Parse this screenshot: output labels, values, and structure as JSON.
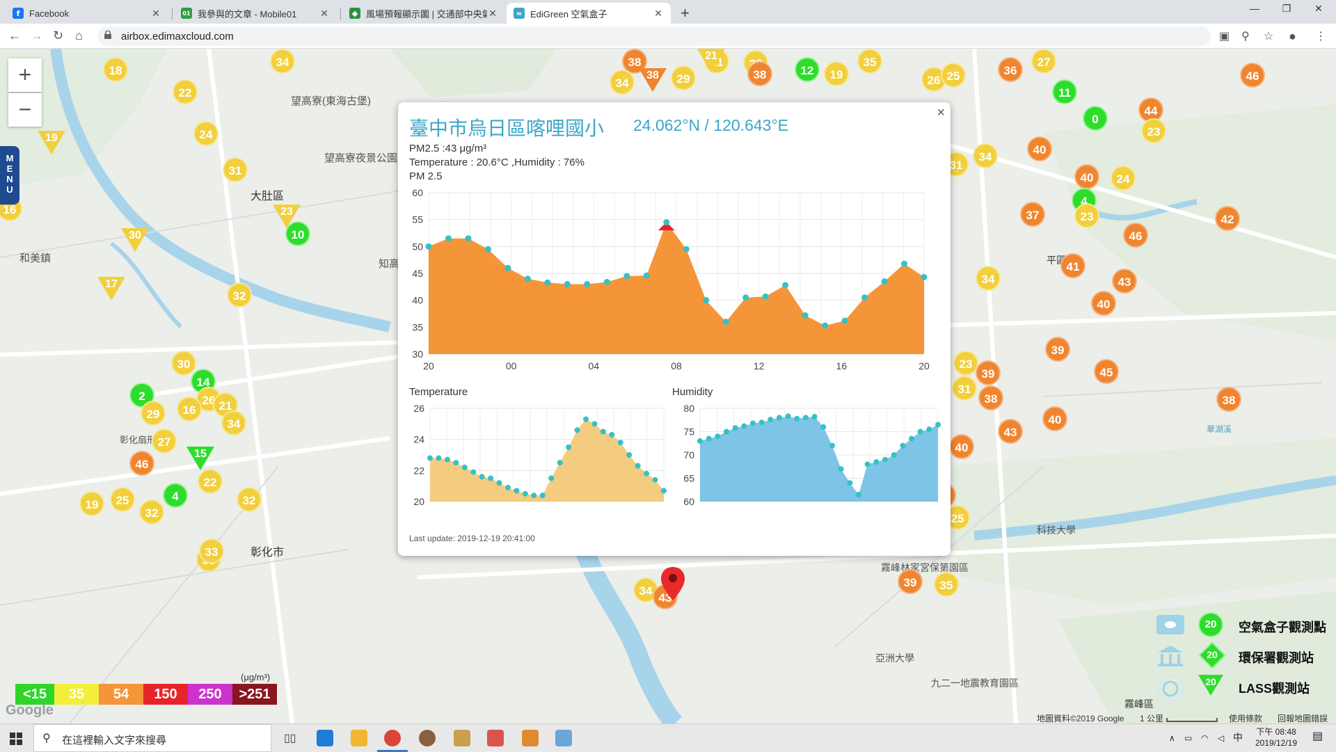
{
  "browser": {
    "tabs": [
      {
        "title": "Facebook",
        "icon": "facebook-icon",
        "color": "#1877f2",
        "glyph": "f",
        "active": false
      },
      {
        "title": "我參與的文章 - Mobile01",
        "icon": "mobile01-icon",
        "color": "#2f9e44",
        "glyph": "01",
        "active": false
      },
      {
        "title": "風場預報顯示圖 | 交通部中央氣象局",
        "icon": "cwb-icon",
        "color": "#2f8f3f",
        "glyph": "◆",
        "active": false
      },
      {
        "title": "EdiGreen 空氣盒子",
        "icon": "edigreen-icon",
        "color": "#3aa6c8",
        "glyph": "≈",
        "active": true
      }
    ],
    "url": "airbox.edimaxcloud.com"
  },
  "map": {
    "menu_label": [
      "M",
      "E",
      "N",
      "U"
    ],
    "zoom_in": "+",
    "zoom_out": "−",
    "place_labels": [
      "望高寮(東海古堡)",
      "望高寮夜景公園",
      "大肚區",
      "和美鎮",
      "知高",
      "彰化扇形車",
      "彰化市",
      "平區",
      "亞洲大學",
      "九二一地震教育園區",
      "霧峰林家宮保第園區",
      "科技大學",
      "霧峰區",
      "華湖溪"
    ],
    "markers": [
      {
        "v": "18",
        "c": "y"
      },
      {
        "v": "22",
        "c": "y"
      },
      {
        "v": "34",
        "c": "y"
      },
      {
        "v": "24",
        "c": "y"
      },
      {
        "v": "31",
        "c": "y"
      },
      {
        "v": "16",
        "c": "y"
      },
      {
        "v": "32",
        "c": "y"
      },
      {
        "v": "30",
        "c": "y"
      },
      {
        "v": "14",
        "c": "g"
      },
      {
        "v": "2",
        "c": "g"
      },
      {
        "v": "29",
        "c": "y"
      },
      {
        "v": "26",
        "c": "y"
      },
      {
        "v": "16",
        "c": "y"
      },
      {
        "v": "21",
        "c": "y"
      },
      {
        "v": "34",
        "c": "y"
      },
      {
        "v": "27",
        "c": "y"
      },
      {
        "v": "46",
        "c": "o"
      },
      {
        "v": "22",
        "c": "y"
      },
      {
        "v": "19",
        "c": "y"
      },
      {
        "v": "25",
        "c": "y"
      },
      {
        "v": "32",
        "c": "y"
      },
      {
        "v": "4",
        "c": "g"
      },
      {
        "v": "32",
        "c": "y"
      },
      {
        "v": "33",
        "c": "y"
      },
      {
        "v": "10",
        "c": "g"
      },
      {
        "v": "38",
        "c": "o"
      },
      {
        "v": "34",
        "c": "y"
      },
      {
        "v": "29",
        "c": "y"
      },
      {
        "v": "21",
        "c": "y"
      },
      {
        "v": "28",
        "c": "y"
      },
      {
        "v": "38",
        "c": "o"
      },
      {
        "v": "12",
        "c": "g"
      },
      {
        "v": "19",
        "c": "y"
      },
      {
        "v": "35",
        "c": "y"
      },
      {
        "v": "26",
        "c": "y"
      },
      {
        "v": "25",
        "c": "y"
      },
      {
        "v": "36",
        "c": "o"
      },
      {
        "v": "27",
        "c": "y"
      },
      {
        "v": "11",
        "c": "g"
      },
      {
        "v": "46",
        "c": "o"
      },
      {
        "v": "0",
        "c": "g"
      },
      {
        "v": "44",
        "c": "o"
      },
      {
        "v": "23",
        "c": "y"
      },
      {
        "v": "40",
        "c": "o"
      },
      {
        "v": "34",
        "c": "y"
      },
      {
        "v": "31",
        "c": "y"
      },
      {
        "v": "40",
        "c": "o"
      },
      {
        "v": "24",
        "c": "y"
      },
      {
        "v": "4",
        "c": "g"
      },
      {
        "v": "37",
        "c": "o"
      },
      {
        "v": "23",
        "c": "y"
      },
      {
        "v": "42",
        "c": "o"
      },
      {
        "v": "46",
        "c": "o"
      },
      {
        "v": "41",
        "c": "o"
      },
      {
        "v": "34",
        "c": "y"
      },
      {
        "v": "43",
        "c": "o"
      },
      {
        "v": "40",
        "c": "o"
      },
      {
        "v": "39",
        "c": "o"
      },
      {
        "v": "23",
        "c": "y"
      },
      {
        "v": "39",
        "c": "o"
      },
      {
        "v": "45",
        "c": "o"
      },
      {
        "v": "31",
        "c": "y"
      },
      {
        "v": "38",
        "c": "o"
      },
      {
        "v": "38",
        "c": "o"
      },
      {
        "v": "40",
        "c": "o"
      },
      {
        "v": "43",
        "c": "o"
      },
      {
        "v": "40",
        "c": "o"
      },
      {
        "v": "11",
        "c": "g"
      },
      {
        "v": "37",
        "c": "o"
      },
      {
        "v": "25",
        "c": "y"
      },
      {
        "v": "33",
        "c": "y"
      },
      {
        "v": "35",
        "c": "y"
      },
      {
        "v": "34",
        "c": "y"
      },
      {
        "v": "39",
        "c": "o"
      },
      {
        "v": "35",
        "c": "y"
      },
      {
        "v": "43",
        "c": "o"
      },
      {
        "v": "33",
        "c": "y"
      }
    ],
    "triangles": [
      {
        "v": "19"
      },
      {
        "v": "23"
      },
      {
        "v": "30"
      },
      {
        "v": "17"
      },
      {
        "v": "15"
      },
      {
        "v": "21"
      },
      {
        "v": "38"
      }
    ]
  },
  "popup": {
    "station": "臺中市烏日區喀哩國小",
    "coord": "24.062°N / 120.643°E",
    "pm25_line": "PM2.5 :43 μg/m³",
    "temp_line": "Temperature : 20.6°C ,Humidity : 76%",
    "chart_title": "PM 2.5",
    "temp_title": "Temperature",
    "humidity_title": "Humidity",
    "last_update": "Last update: 2019-12-19 20:41:00",
    "close": "×"
  },
  "chart_data": [
    {
      "type": "area",
      "title": "PM 2.5",
      "x_tick_labels": [
        "20",
        "00",
        "04",
        "08",
        "12",
        "16",
        "20"
      ],
      "ylim": [
        30,
        60
      ],
      "y_ticks": [
        30,
        35,
        40,
        45,
        50,
        55,
        60
      ],
      "values": [
        50,
        51.5,
        51.5,
        49.5,
        46,
        44,
        43.3,
        43,
        43,
        43.4,
        44.5,
        44.6,
        54.5,
        49.5,
        40,
        36,
        40.5,
        40.7,
        42.8,
        37.2,
        35.3,
        36.2,
        40.5,
        43.5,
        46.8,
        44.3
      ],
      "color": "#f5953a",
      "peak_color": "#e8242a"
    },
    {
      "type": "area",
      "title": "Temperature",
      "ylim": [
        20,
        26
      ],
      "y_ticks": [
        20,
        22,
        24,
        26
      ],
      "values": [
        22.8,
        22.8,
        22.7,
        22.5,
        22.2,
        21.9,
        21.6,
        21.5,
        21.2,
        20.9,
        20.7,
        20.5,
        20.4,
        20.4,
        21.5,
        22.5,
        23.5,
        24.6,
        25.3,
        25.0,
        24.5,
        24.3,
        23.8,
        23.0,
        22.3,
        21.8,
        21.4,
        20.7
      ],
      "color": "#f3cc7f"
    },
    {
      "type": "area",
      "title": "Humidity",
      "ylim": [
        60,
        80
      ],
      "y_ticks": [
        60,
        65,
        70,
        75,
        80
      ],
      "values": [
        73,
        73.5,
        74,
        75,
        75.8,
        76.2,
        76.8,
        77,
        77.6,
        78,
        78.3,
        77.8,
        78,
        78.2,
        76,
        72,
        67,
        64,
        61.5,
        68,
        68.5,
        69,
        70,
        72,
        73.5,
        75,
        75.5,
        76.5
      ],
      "color": "#7ec4e6"
    }
  ],
  "scale_legend": {
    "unit": "(μg/m³)",
    "items": [
      {
        "label": "<15",
        "color": "#2ed62a"
      },
      {
        "label": "35",
        "color": "#f2ee3c"
      },
      {
        "label": "54",
        "color": "#f5953a"
      },
      {
        "label": "150",
        "color": "#e8242a"
      },
      {
        "label": "250",
        "color": "#cc33cc"
      },
      {
        "label": ">251",
        "color": "#8a1520"
      }
    ]
  },
  "type_legend": [
    {
      "label": "空氣盒子觀測點",
      "value": "20",
      "icon": "airbox-icon"
    },
    {
      "label": "環保署觀測站",
      "value": "20",
      "icon": "epa-icon"
    },
    {
      "label": "LASS觀測站",
      "value": "20",
      "icon": "lass-icon"
    }
  ],
  "map_footer": {
    "attribution": "地圖資料©2019 Google",
    "scale": "1 公里",
    "terms": "使用條款",
    "report": "回報地圖錯誤",
    "google": "Google"
  },
  "taskbar": {
    "search_placeholder": "在這裡輸入文字來搜尋",
    "time": "下午 08:48",
    "date": "2019/12/19",
    "ime": "中"
  }
}
